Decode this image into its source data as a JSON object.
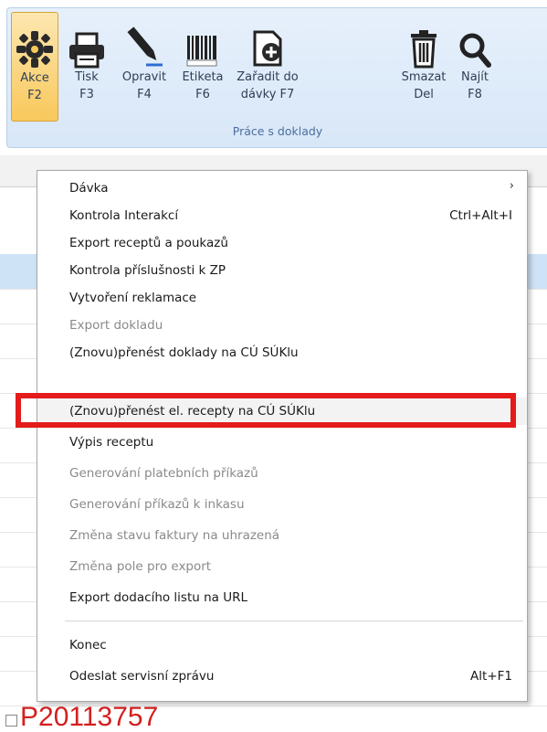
{
  "ribbon": {
    "buttons": [
      {
        "l1": "Akce",
        "l2": "F2",
        "icon": "puzzle-gear-icon"
      },
      {
        "l1": "Tisk",
        "l2": "F3",
        "icon": "printer-icon"
      },
      {
        "l1": "Opravit",
        "l2": "F4",
        "icon": "pen-icon"
      },
      {
        "l1": "Etiketa",
        "l2": "F6",
        "icon": "barcode-icon"
      },
      {
        "l1": "Zařadit do",
        "l2": "dávky F7",
        "icon": "add-document-icon"
      },
      {
        "l1": "Smazat",
        "l2": "Del",
        "icon": "trash-icon"
      },
      {
        "l1": "Najít",
        "l2": "F8",
        "icon": "search-icon"
      }
    ],
    "group_label": "Práce s doklady"
  },
  "menu": {
    "items": [
      {
        "label": "Dávka",
        "shortcut": "",
        "submenu": true,
        "disabled": false
      },
      {
        "label": "Kontrola Interakcí",
        "shortcut": "Ctrl+Alt+I",
        "disabled": false
      },
      {
        "label": "Export receptů a poukazů",
        "shortcut": "",
        "disabled": false
      },
      {
        "label": "Kontrola příslušnosti k ZP",
        "shortcut": "",
        "disabled": false
      },
      {
        "label": "Vytvoření reklamace",
        "shortcut": "",
        "disabled": false
      },
      {
        "label": "Export dokladu",
        "shortcut": "",
        "disabled": true
      },
      {
        "label": "(Znovu)přenést doklady na CÚ SÚKlu",
        "shortcut": "",
        "disabled": false
      },
      {
        "label": "(Znovu)přenést el. recepty na CÚ SÚKlu",
        "shortcut": "",
        "disabled": false,
        "selected": true
      },
      {
        "label": "Výpis receptu",
        "shortcut": "",
        "disabled": false
      },
      {
        "label": "Generování platebních příkazů",
        "shortcut": "",
        "disabled": true
      },
      {
        "label": "Generování příkazů k inkasu",
        "shortcut": "",
        "disabled": true
      },
      {
        "label": "Změna stavu faktury na uhrazená",
        "shortcut": "",
        "disabled": true
      },
      {
        "label": "Změna pole pro export",
        "shortcut": "",
        "disabled": true
      },
      {
        "label": "Export dodacího listu na URL",
        "shortcut": "",
        "disabled": false
      },
      {
        "label": "Konec",
        "shortcut": "",
        "disabled": false
      },
      {
        "label": "Odeslat servisní zprávu",
        "shortcut": "Alt+F1",
        "disabled": false
      }
    ]
  },
  "background": {
    "record_id": "P20113757"
  },
  "colors": {
    "accent": "#f8c85c",
    "highlight_box": "#e41b1b",
    "record_id": "#d42020"
  }
}
